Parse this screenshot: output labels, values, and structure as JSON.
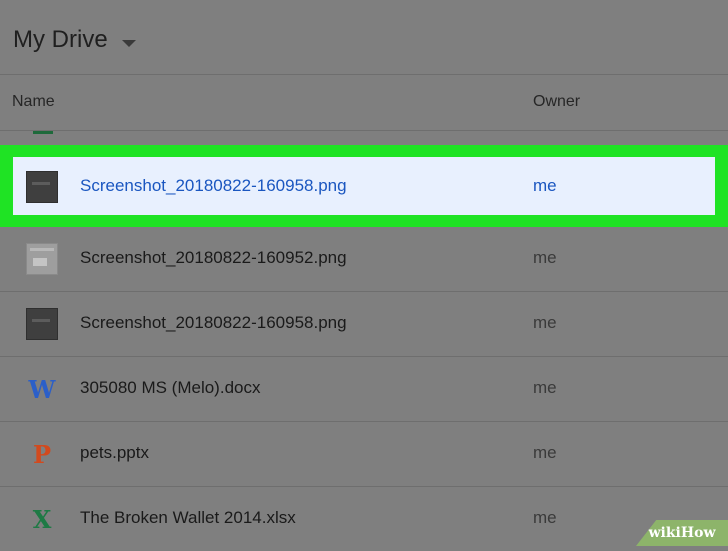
{
  "header": {
    "title": "My Drive"
  },
  "columns": {
    "name": "Name",
    "owner": "Owner"
  },
  "selected": {
    "name": "Screenshot_20180822-160958.png",
    "owner": "me",
    "icon": "image-thumbnail-dark-icon"
  },
  "files": [
    {
      "name": "Screenshot_20180822-160952.png",
      "owner": "me",
      "icon": "image-thumbnail-light-icon"
    },
    {
      "name": "Screenshot_20180822-160958.png",
      "owner": "me",
      "icon": "image-thumbnail-dark-icon"
    },
    {
      "name": "305080 MS (Melo).docx",
      "owner": "me",
      "icon": "word-doc-icon",
      "glyph": "W",
      "color": "#2b5fc9"
    },
    {
      "name": "pets.pptx",
      "owner": "me",
      "icon": "powerpoint-icon",
      "glyph": "P",
      "color": "#d24a1e"
    },
    {
      "name": "The Broken Wallet 2014.xlsx",
      "owner": "me",
      "icon": "excel-sheet-icon",
      "glyph": "X",
      "color": "#1e7a45"
    }
  ],
  "watermark": {
    "text": "wikiHow"
  },
  "colors": {
    "highlight_border": "#1fe324",
    "selected_bg": "#e8f0fe",
    "link_blue": "#1a56c0"
  }
}
